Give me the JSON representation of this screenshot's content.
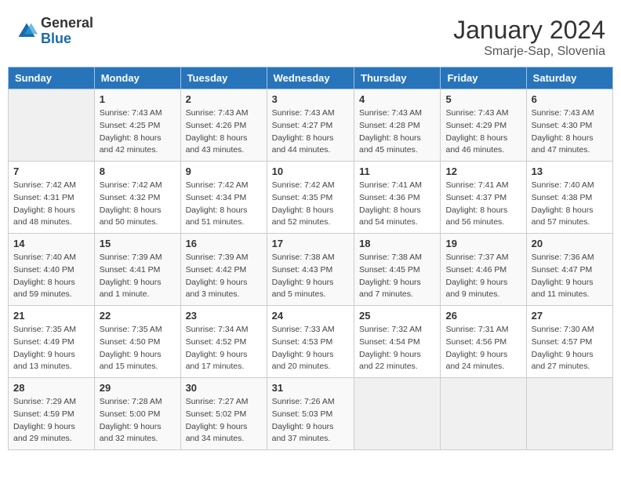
{
  "header": {
    "logo_general": "General",
    "logo_blue": "Blue",
    "title": "January 2024",
    "subtitle": "Smarje-Sap, Slovenia"
  },
  "weekdays": [
    "Sunday",
    "Monday",
    "Tuesday",
    "Wednesday",
    "Thursday",
    "Friday",
    "Saturday"
  ],
  "weeks": [
    [
      {
        "day": "",
        "sunrise": "",
        "sunset": "",
        "daylight": ""
      },
      {
        "day": "1",
        "sunrise": "Sunrise: 7:43 AM",
        "sunset": "Sunset: 4:25 PM",
        "daylight": "Daylight: 8 hours and 42 minutes."
      },
      {
        "day": "2",
        "sunrise": "Sunrise: 7:43 AM",
        "sunset": "Sunset: 4:26 PM",
        "daylight": "Daylight: 8 hours and 43 minutes."
      },
      {
        "day": "3",
        "sunrise": "Sunrise: 7:43 AM",
        "sunset": "Sunset: 4:27 PM",
        "daylight": "Daylight: 8 hours and 44 minutes."
      },
      {
        "day": "4",
        "sunrise": "Sunrise: 7:43 AM",
        "sunset": "Sunset: 4:28 PM",
        "daylight": "Daylight: 8 hours and 45 minutes."
      },
      {
        "day": "5",
        "sunrise": "Sunrise: 7:43 AM",
        "sunset": "Sunset: 4:29 PM",
        "daylight": "Daylight: 8 hours and 46 minutes."
      },
      {
        "day": "6",
        "sunrise": "Sunrise: 7:43 AM",
        "sunset": "Sunset: 4:30 PM",
        "daylight": "Daylight: 8 hours and 47 minutes."
      }
    ],
    [
      {
        "day": "7",
        "sunrise": "Sunrise: 7:42 AM",
        "sunset": "Sunset: 4:31 PM",
        "daylight": "Daylight: 8 hours and 48 minutes."
      },
      {
        "day": "8",
        "sunrise": "Sunrise: 7:42 AM",
        "sunset": "Sunset: 4:32 PM",
        "daylight": "Daylight: 8 hours and 50 minutes."
      },
      {
        "day": "9",
        "sunrise": "Sunrise: 7:42 AM",
        "sunset": "Sunset: 4:34 PM",
        "daylight": "Daylight: 8 hours and 51 minutes."
      },
      {
        "day": "10",
        "sunrise": "Sunrise: 7:42 AM",
        "sunset": "Sunset: 4:35 PM",
        "daylight": "Daylight: 8 hours and 52 minutes."
      },
      {
        "day": "11",
        "sunrise": "Sunrise: 7:41 AM",
        "sunset": "Sunset: 4:36 PM",
        "daylight": "Daylight: 8 hours and 54 minutes."
      },
      {
        "day": "12",
        "sunrise": "Sunrise: 7:41 AM",
        "sunset": "Sunset: 4:37 PM",
        "daylight": "Daylight: 8 hours and 56 minutes."
      },
      {
        "day": "13",
        "sunrise": "Sunrise: 7:40 AM",
        "sunset": "Sunset: 4:38 PM",
        "daylight": "Daylight: 8 hours and 57 minutes."
      }
    ],
    [
      {
        "day": "14",
        "sunrise": "Sunrise: 7:40 AM",
        "sunset": "Sunset: 4:40 PM",
        "daylight": "Daylight: 8 hours and 59 minutes."
      },
      {
        "day": "15",
        "sunrise": "Sunrise: 7:39 AM",
        "sunset": "Sunset: 4:41 PM",
        "daylight": "Daylight: 9 hours and 1 minute."
      },
      {
        "day": "16",
        "sunrise": "Sunrise: 7:39 AM",
        "sunset": "Sunset: 4:42 PM",
        "daylight": "Daylight: 9 hours and 3 minutes."
      },
      {
        "day": "17",
        "sunrise": "Sunrise: 7:38 AM",
        "sunset": "Sunset: 4:43 PM",
        "daylight": "Daylight: 9 hours and 5 minutes."
      },
      {
        "day": "18",
        "sunrise": "Sunrise: 7:38 AM",
        "sunset": "Sunset: 4:45 PM",
        "daylight": "Daylight: 9 hours and 7 minutes."
      },
      {
        "day": "19",
        "sunrise": "Sunrise: 7:37 AM",
        "sunset": "Sunset: 4:46 PM",
        "daylight": "Daylight: 9 hours and 9 minutes."
      },
      {
        "day": "20",
        "sunrise": "Sunrise: 7:36 AM",
        "sunset": "Sunset: 4:47 PM",
        "daylight": "Daylight: 9 hours and 11 minutes."
      }
    ],
    [
      {
        "day": "21",
        "sunrise": "Sunrise: 7:35 AM",
        "sunset": "Sunset: 4:49 PM",
        "daylight": "Daylight: 9 hours and 13 minutes."
      },
      {
        "day": "22",
        "sunrise": "Sunrise: 7:35 AM",
        "sunset": "Sunset: 4:50 PM",
        "daylight": "Daylight: 9 hours and 15 minutes."
      },
      {
        "day": "23",
        "sunrise": "Sunrise: 7:34 AM",
        "sunset": "Sunset: 4:52 PM",
        "daylight": "Daylight: 9 hours and 17 minutes."
      },
      {
        "day": "24",
        "sunrise": "Sunrise: 7:33 AM",
        "sunset": "Sunset: 4:53 PM",
        "daylight": "Daylight: 9 hours and 20 minutes."
      },
      {
        "day": "25",
        "sunrise": "Sunrise: 7:32 AM",
        "sunset": "Sunset: 4:54 PM",
        "daylight": "Daylight: 9 hours and 22 minutes."
      },
      {
        "day": "26",
        "sunrise": "Sunrise: 7:31 AM",
        "sunset": "Sunset: 4:56 PM",
        "daylight": "Daylight: 9 hours and 24 minutes."
      },
      {
        "day": "27",
        "sunrise": "Sunrise: 7:30 AM",
        "sunset": "Sunset: 4:57 PM",
        "daylight": "Daylight: 9 hours and 27 minutes."
      }
    ],
    [
      {
        "day": "28",
        "sunrise": "Sunrise: 7:29 AM",
        "sunset": "Sunset: 4:59 PM",
        "daylight": "Daylight: 9 hours and 29 minutes."
      },
      {
        "day": "29",
        "sunrise": "Sunrise: 7:28 AM",
        "sunset": "Sunset: 5:00 PM",
        "daylight": "Daylight: 9 hours and 32 minutes."
      },
      {
        "day": "30",
        "sunrise": "Sunrise: 7:27 AM",
        "sunset": "Sunset: 5:02 PM",
        "daylight": "Daylight: 9 hours and 34 minutes."
      },
      {
        "day": "31",
        "sunrise": "Sunrise: 7:26 AM",
        "sunset": "Sunset: 5:03 PM",
        "daylight": "Daylight: 9 hours and 37 minutes."
      },
      {
        "day": "",
        "sunrise": "",
        "sunset": "",
        "daylight": ""
      },
      {
        "day": "",
        "sunrise": "",
        "sunset": "",
        "daylight": ""
      },
      {
        "day": "",
        "sunrise": "",
        "sunset": "",
        "daylight": ""
      }
    ]
  ]
}
